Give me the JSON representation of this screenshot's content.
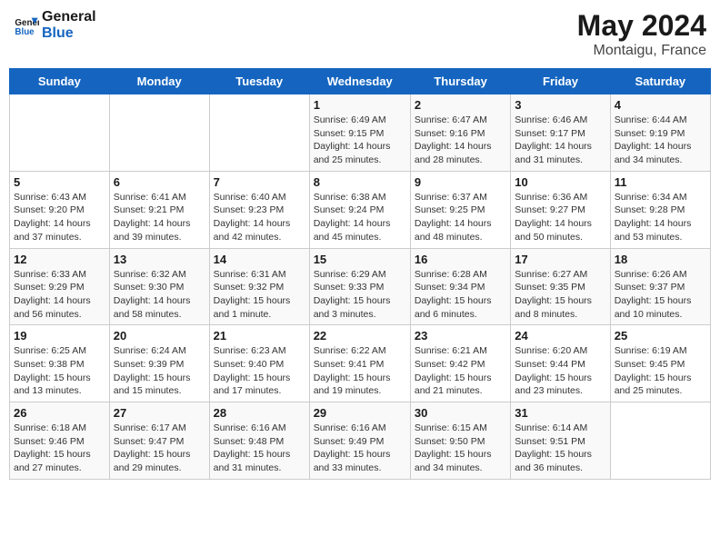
{
  "header": {
    "logo_line1": "General",
    "logo_line2": "Blue",
    "month_year": "May 2024",
    "location": "Montaigu, France"
  },
  "calendar": {
    "weekdays": [
      "Sunday",
      "Monday",
      "Tuesday",
      "Wednesday",
      "Thursday",
      "Friday",
      "Saturday"
    ],
    "weeks": [
      [
        {
          "day": "",
          "info": ""
        },
        {
          "day": "",
          "info": ""
        },
        {
          "day": "",
          "info": ""
        },
        {
          "day": "1",
          "info": "Sunrise: 6:49 AM\nSunset: 9:15 PM\nDaylight: 14 hours\nand 25 minutes."
        },
        {
          "day": "2",
          "info": "Sunrise: 6:47 AM\nSunset: 9:16 PM\nDaylight: 14 hours\nand 28 minutes."
        },
        {
          "day": "3",
          "info": "Sunrise: 6:46 AM\nSunset: 9:17 PM\nDaylight: 14 hours\nand 31 minutes."
        },
        {
          "day": "4",
          "info": "Sunrise: 6:44 AM\nSunset: 9:19 PM\nDaylight: 14 hours\nand 34 minutes."
        }
      ],
      [
        {
          "day": "5",
          "info": "Sunrise: 6:43 AM\nSunset: 9:20 PM\nDaylight: 14 hours\nand 37 minutes."
        },
        {
          "day": "6",
          "info": "Sunrise: 6:41 AM\nSunset: 9:21 PM\nDaylight: 14 hours\nand 39 minutes."
        },
        {
          "day": "7",
          "info": "Sunrise: 6:40 AM\nSunset: 9:23 PM\nDaylight: 14 hours\nand 42 minutes."
        },
        {
          "day": "8",
          "info": "Sunrise: 6:38 AM\nSunset: 9:24 PM\nDaylight: 14 hours\nand 45 minutes."
        },
        {
          "day": "9",
          "info": "Sunrise: 6:37 AM\nSunset: 9:25 PM\nDaylight: 14 hours\nand 48 minutes."
        },
        {
          "day": "10",
          "info": "Sunrise: 6:36 AM\nSunset: 9:27 PM\nDaylight: 14 hours\nand 50 minutes."
        },
        {
          "day": "11",
          "info": "Sunrise: 6:34 AM\nSunset: 9:28 PM\nDaylight: 14 hours\nand 53 minutes."
        }
      ],
      [
        {
          "day": "12",
          "info": "Sunrise: 6:33 AM\nSunset: 9:29 PM\nDaylight: 14 hours\nand 56 minutes."
        },
        {
          "day": "13",
          "info": "Sunrise: 6:32 AM\nSunset: 9:30 PM\nDaylight: 14 hours\nand 58 minutes."
        },
        {
          "day": "14",
          "info": "Sunrise: 6:31 AM\nSunset: 9:32 PM\nDaylight: 15 hours\nand 1 minute."
        },
        {
          "day": "15",
          "info": "Sunrise: 6:29 AM\nSunset: 9:33 PM\nDaylight: 15 hours\nand 3 minutes."
        },
        {
          "day": "16",
          "info": "Sunrise: 6:28 AM\nSunset: 9:34 PM\nDaylight: 15 hours\nand 6 minutes."
        },
        {
          "day": "17",
          "info": "Sunrise: 6:27 AM\nSunset: 9:35 PM\nDaylight: 15 hours\nand 8 minutes."
        },
        {
          "day": "18",
          "info": "Sunrise: 6:26 AM\nSunset: 9:37 PM\nDaylight: 15 hours\nand 10 minutes."
        }
      ],
      [
        {
          "day": "19",
          "info": "Sunrise: 6:25 AM\nSunset: 9:38 PM\nDaylight: 15 hours\nand 13 minutes."
        },
        {
          "day": "20",
          "info": "Sunrise: 6:24 AM\nSunset: 9:39 PM\nDaylight: 15 hours\nand 15 minutes."
        },
        {
          "day": "21",
          "info": "Sunrise: 6:23 AM\nSunset: 9:40 PM\nDaylight: 15 hours\nand 17 minutes."
        },
        {
          "day": "22",
          "info": "Sunrise: 6:22 AM\nSunset: 9:41 PM\nDaylight: 15 hours\nand 19 minutes."
        },
        {
          "day": "23",
          "info": "Sunrise: 6:21 AM\nSunset: 9:42 PM\nDaylight: 15 hours\nand 21 minutes."
        },
        {
          "day": "24",
          "info": "Sunrise: 6:20 AM\nSunset: 9:44 PM\nDaylight: 15 hours\nand 23 minutes."
        },
        {
          "day": "25",
          "info": "Sunrise: 6:19 AM\nSunset: 9:45 PM\nDaylight: 15 hours\nand 25 minutes."
        }
      ],
      [
        {
          "day": "26",
          "info": "Sunrise: 6:18 AM\nSunset: 9:46 PM\nDaylight: 15 hours\nand 27 minutes."
        },
        {
          "day": "27",
          "info": "Sunrise: 6:17 AM\nSunset: 9:47 PM\nDaylight: 15 hours\nand 29 minutes."
        },
        {
          "day": "28",
          "info": "Sunrise: 6:16 AM\nSunset: 9:48 PM\nDaylight: 15 hours\nand 31 minutes."
        },
        {
          "day": "29",
          "info": "Sunrise: 6:16 AM\nSunset: 9:49 PM\nDaylight: 15 hours\nand 33 minutes."
        },
        {
          "day": "30",
          "info": "Sunrise: 6:15 AM\nSunset: 9:50 PM\nDaylight: 15 hours\nand 34 minutes."
        },
        {
          "day": "31",
          "info": "Sunrise: 6:14 AM\nSunset: 9:51 PM\nDaylight: 15 hours\nand 36 minutes."
        },
        {
          "day": "",
          "info": ""
        }
      ]
    ]
  }
}
